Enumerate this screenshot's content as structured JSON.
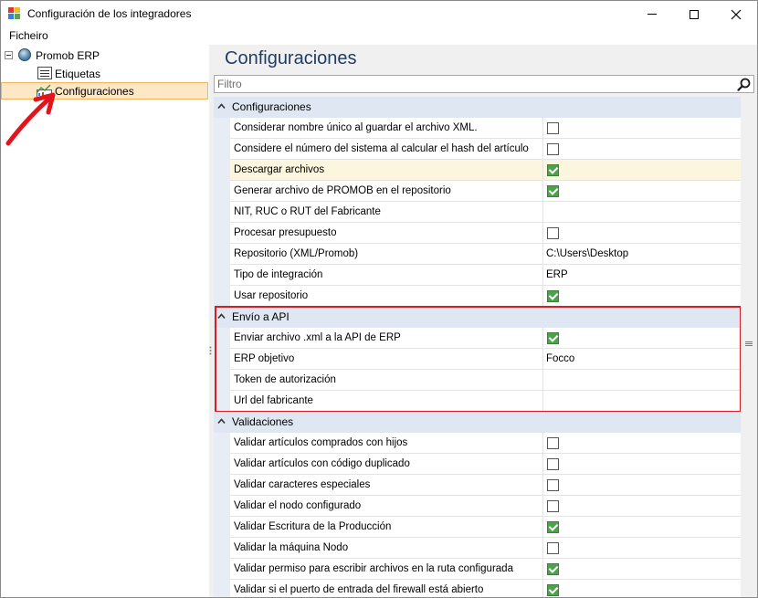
{
  "window": {
    "title": "Configuración de los integradores"
  },
  "menu": {
    "file_label": "Ficheiro"
  },
  "tree": {
    "root_label": "Promob ERP",
    "children": [
      {
        "label": "Etiquetas"
      },
      {
        "label": "Configuraciones"
      }
    ],
    "selected": "Configuraciones"
  },
  "panel": {
    "title": "Configuraciones",
    "filter_placeholder": "Filtro"
  },
  "categories": [
    {
      "label": "Configuraciones",
      "rows": [
        {
          "name": "Considerar nombre único al guardar el archivo XML.",
          "type": "checkbox",
          "checked": false
        },
        {
          "name": "Considere el número del sistema al calcular el hash del artículo",
          "type": "checkbox",
          "checked": false
        },
        {
          "name": "Descargar archivos",
          "type": "checkbox",
          "checked": true,
          "highlight": true
        },
        {
          "name": "Generar archivo de PROMOB en el repositorio",
          "type": "checkbox",
          "checked": true
        },
        {
          "name": "NIT, RUC o RUT del Fabricante",
          "type": "text",
          "value": ""
        },
        {
          "name": "Procesar presupuesto",
          "type": "checkbox",
          "checked": false
        },
        {
          "name": "Repositorio (XML/Promob)",
          "type": "text",
          "value": "C:\\Users\\Desktop"
        },
        {
          "name": "Tipo de integración",
          "type": "text",
          "value": "ERP"
        },
        {
          "name": "Usar repositorio",
          "type": "checkbox",
          "checked": true
        }
      ]
    },
    {
      "label": "Envío a API",
      "rows": [
        {
          "name": "Enviar archivo .xml a la API de ERP",
          "type": "checkbox",
          "checked": true
        },
        {
          "name": "ERP objetivo",
          "type": "text",
          "value": "Focco"
        },
        {
          "name": "Token de autorización",
          "type": "text",
          "value": ""
        },
        {
          "name": "Url del fabricante",
          "type": "text",
          "value": ""
        }
      ]
    },
    {
      "label": "Validaciones",
      "rows": [
        {
          "name": "Validar artículos comprados con hijos",
          "type": "checkbox",
          "checked": false
        },
        {
          "name": "Validar artículos con código duplicado",
          "type": "checkbox",
          "checked": false
        },
        {
          "name": "Validar caracteres especiales",
          "type": "checkbox",
          "checked": false
        },
        {
          "name": "Validar el nodo configurado",
          "type": "checkbox",
          "checked": false
        },
        {
          "name": "Validar Escritura de la Producción",
          "type": "checkbox",
          "checked": true
        },
        {
          "name": "Validar la máquina Nodo",
          "type": "checkbox",
          "checked": false
        },
        {
          "name": "Validar permiso para escribir archivos en la ruta configurada",
          "type": "checkbox",
          "checked": true
        },
        {
          "name": "Validar si el puerto de entrada del firewall está abierto",
          "type": "checkbox",
          "checked": true
        }
      ]
    }
  ],
  "colors": {
    "accent_title": "#1f3e66",
    "category_bg": "#dfe7f3",
    "check_green": "#4ea24c",
    "highlight_box": "#d41f27",
    "selection_bg": "#fde7c4",
    "annotation_arrow": "#e3141b"
  },
  "icons": {
    "app": "app-icon",
    "root": "globe-icon",
    "etiquetas": "label-list-icon",
    "configuraciones": "chart-settings-icon",
    "search": "search-icon",
    "annotation": "red-arrow-annotation"
  }
}
